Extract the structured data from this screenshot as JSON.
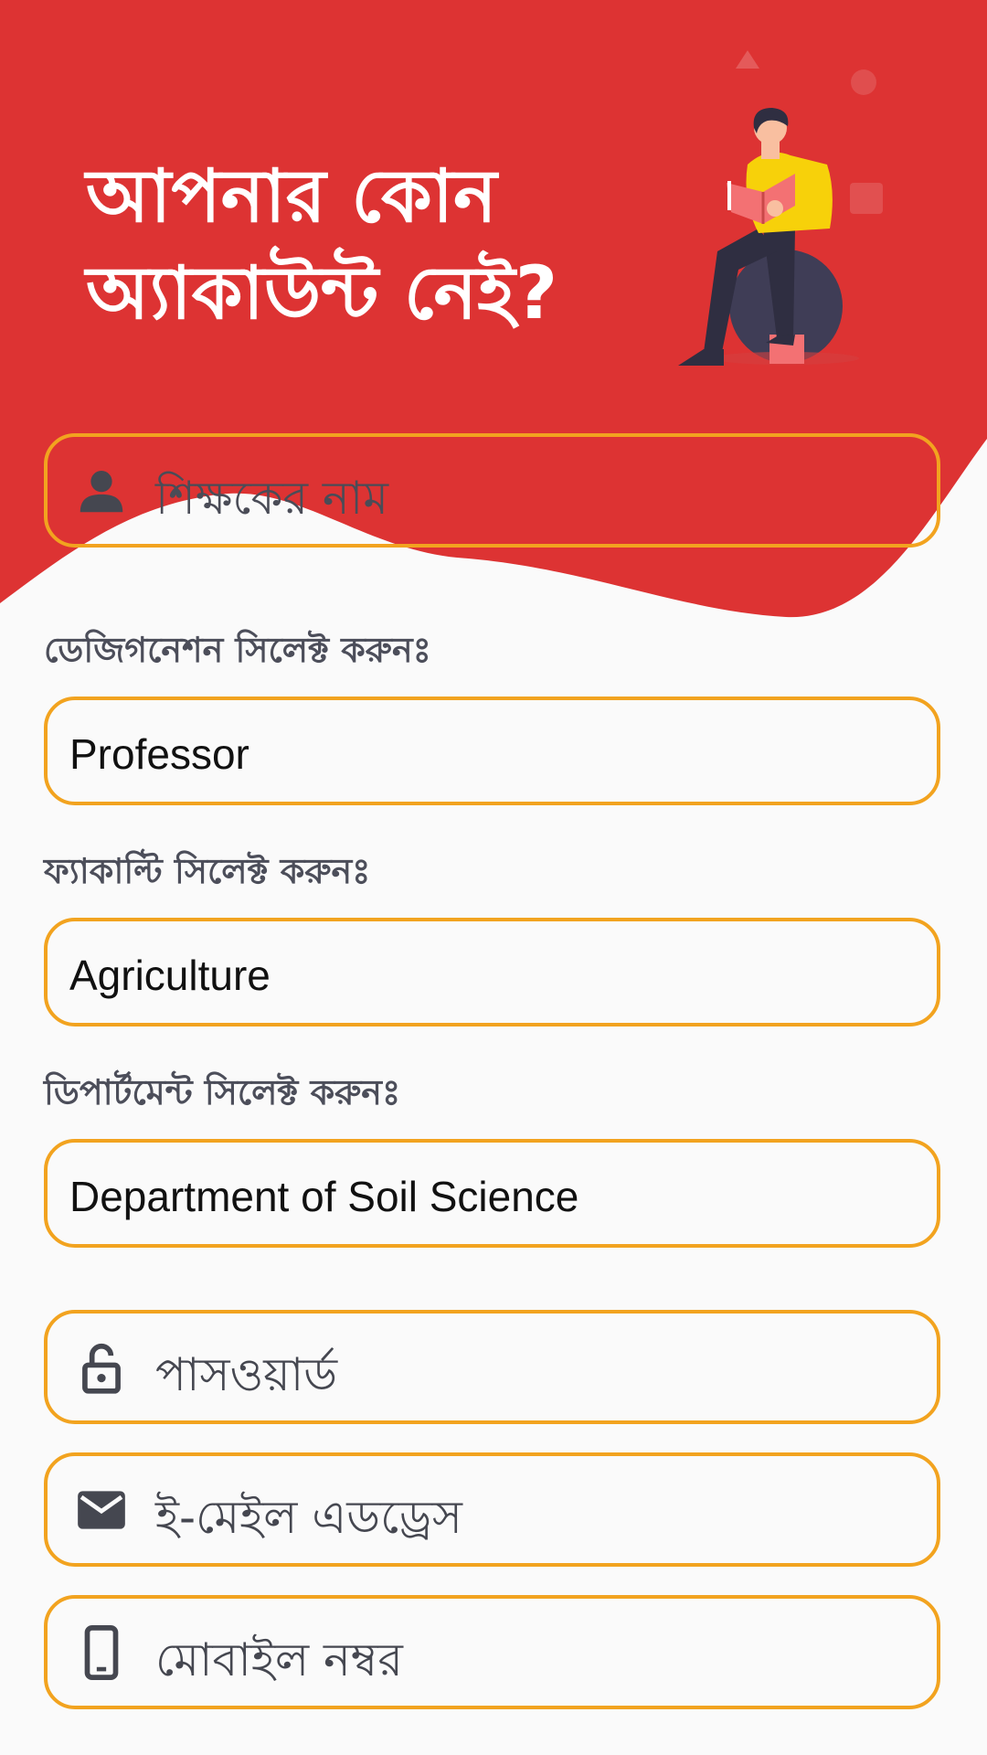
{
  "header": {
    "title_line1": "আপনার কোন",
    "title_line2": "অ্যাকাউন্ট নেই?",
    "bg_color": "#dd3333"
  },
  "form": {
    "name_placeholder": "শিক্ষকের নাম",
    "designation_label": "ডেজিগনেশন সিলেক্ট করুনঃ",
    "designation_value": "Professor",
    "faculty_label": "ফ্যাকাল্টি সিলেক্ট করুনঃ",
    "faculty_value": "Agriculture",
    "department_label": "ডিপার্টমেন্ট সিলেক্ট করুনঃ",
    "department_value": "Department of Soil Science",
    "password_placeholder": "পাসওয়ার্ড",
    "email_placeholder": "ই-মেইল এডড্রেস",
    "mobile_placeholder": "মোবাইল নম্বর"
  },
  "icons": {
    "name": "person-icon",
    "password": "lock-open-icon",
    "email": "envelope-icon",
    "mobile": "smartphone-icon"
  },
  "colors": {
    "accent_border": "#f2a31f",
    "header_red": "#dd3333",
    "icon_dark": "#454750",
    "background": "#fafafa"
  }
}
